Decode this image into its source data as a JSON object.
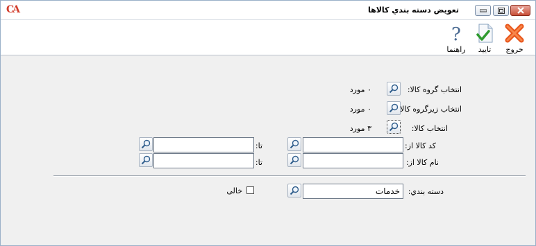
{
  "window": {
    "title": "تعويض دسته بندي کالاها",
    "logo": "CA"
  },
  "toolbar": {
    "exit_label": "خروج",
    "confirm_label": "تاييد",
    "help_label": "راهنما"
  },
  "form": {
    "group_label": "انتخاب گروه کالا:",
    "group_count": "۰ مورد",
    "subgroup_label": "انتخاب زيرگروه کالا:",
    "subgroup_count": "۰ مورد",
    "item_label": "انتخاب کالا:",
    "item_count": "۳ مورد",
    "code_from_label": "کد کالا از:",
    "code_to_label": "تا:",
    "code_from_value": "",
    "code_to_value": "",
    "name_from_label": "نام کالا از:",
    "name_to_label": "تا:",
    "name_from_value": "",
    "name_to_value": "",
    "category_label": "دسته بندي:",
    "category_value": "خدمات",
    "empty_label": "خالی"
  },
  "icons": [
    "app-logo",
    "minimize-icon",
    "maximize-icon",
    "close-icon",
    "exit-x-icon",
    "confirm-document-icon",
    "help-question-icon",
    "magnifier-icon"
  ]
}
